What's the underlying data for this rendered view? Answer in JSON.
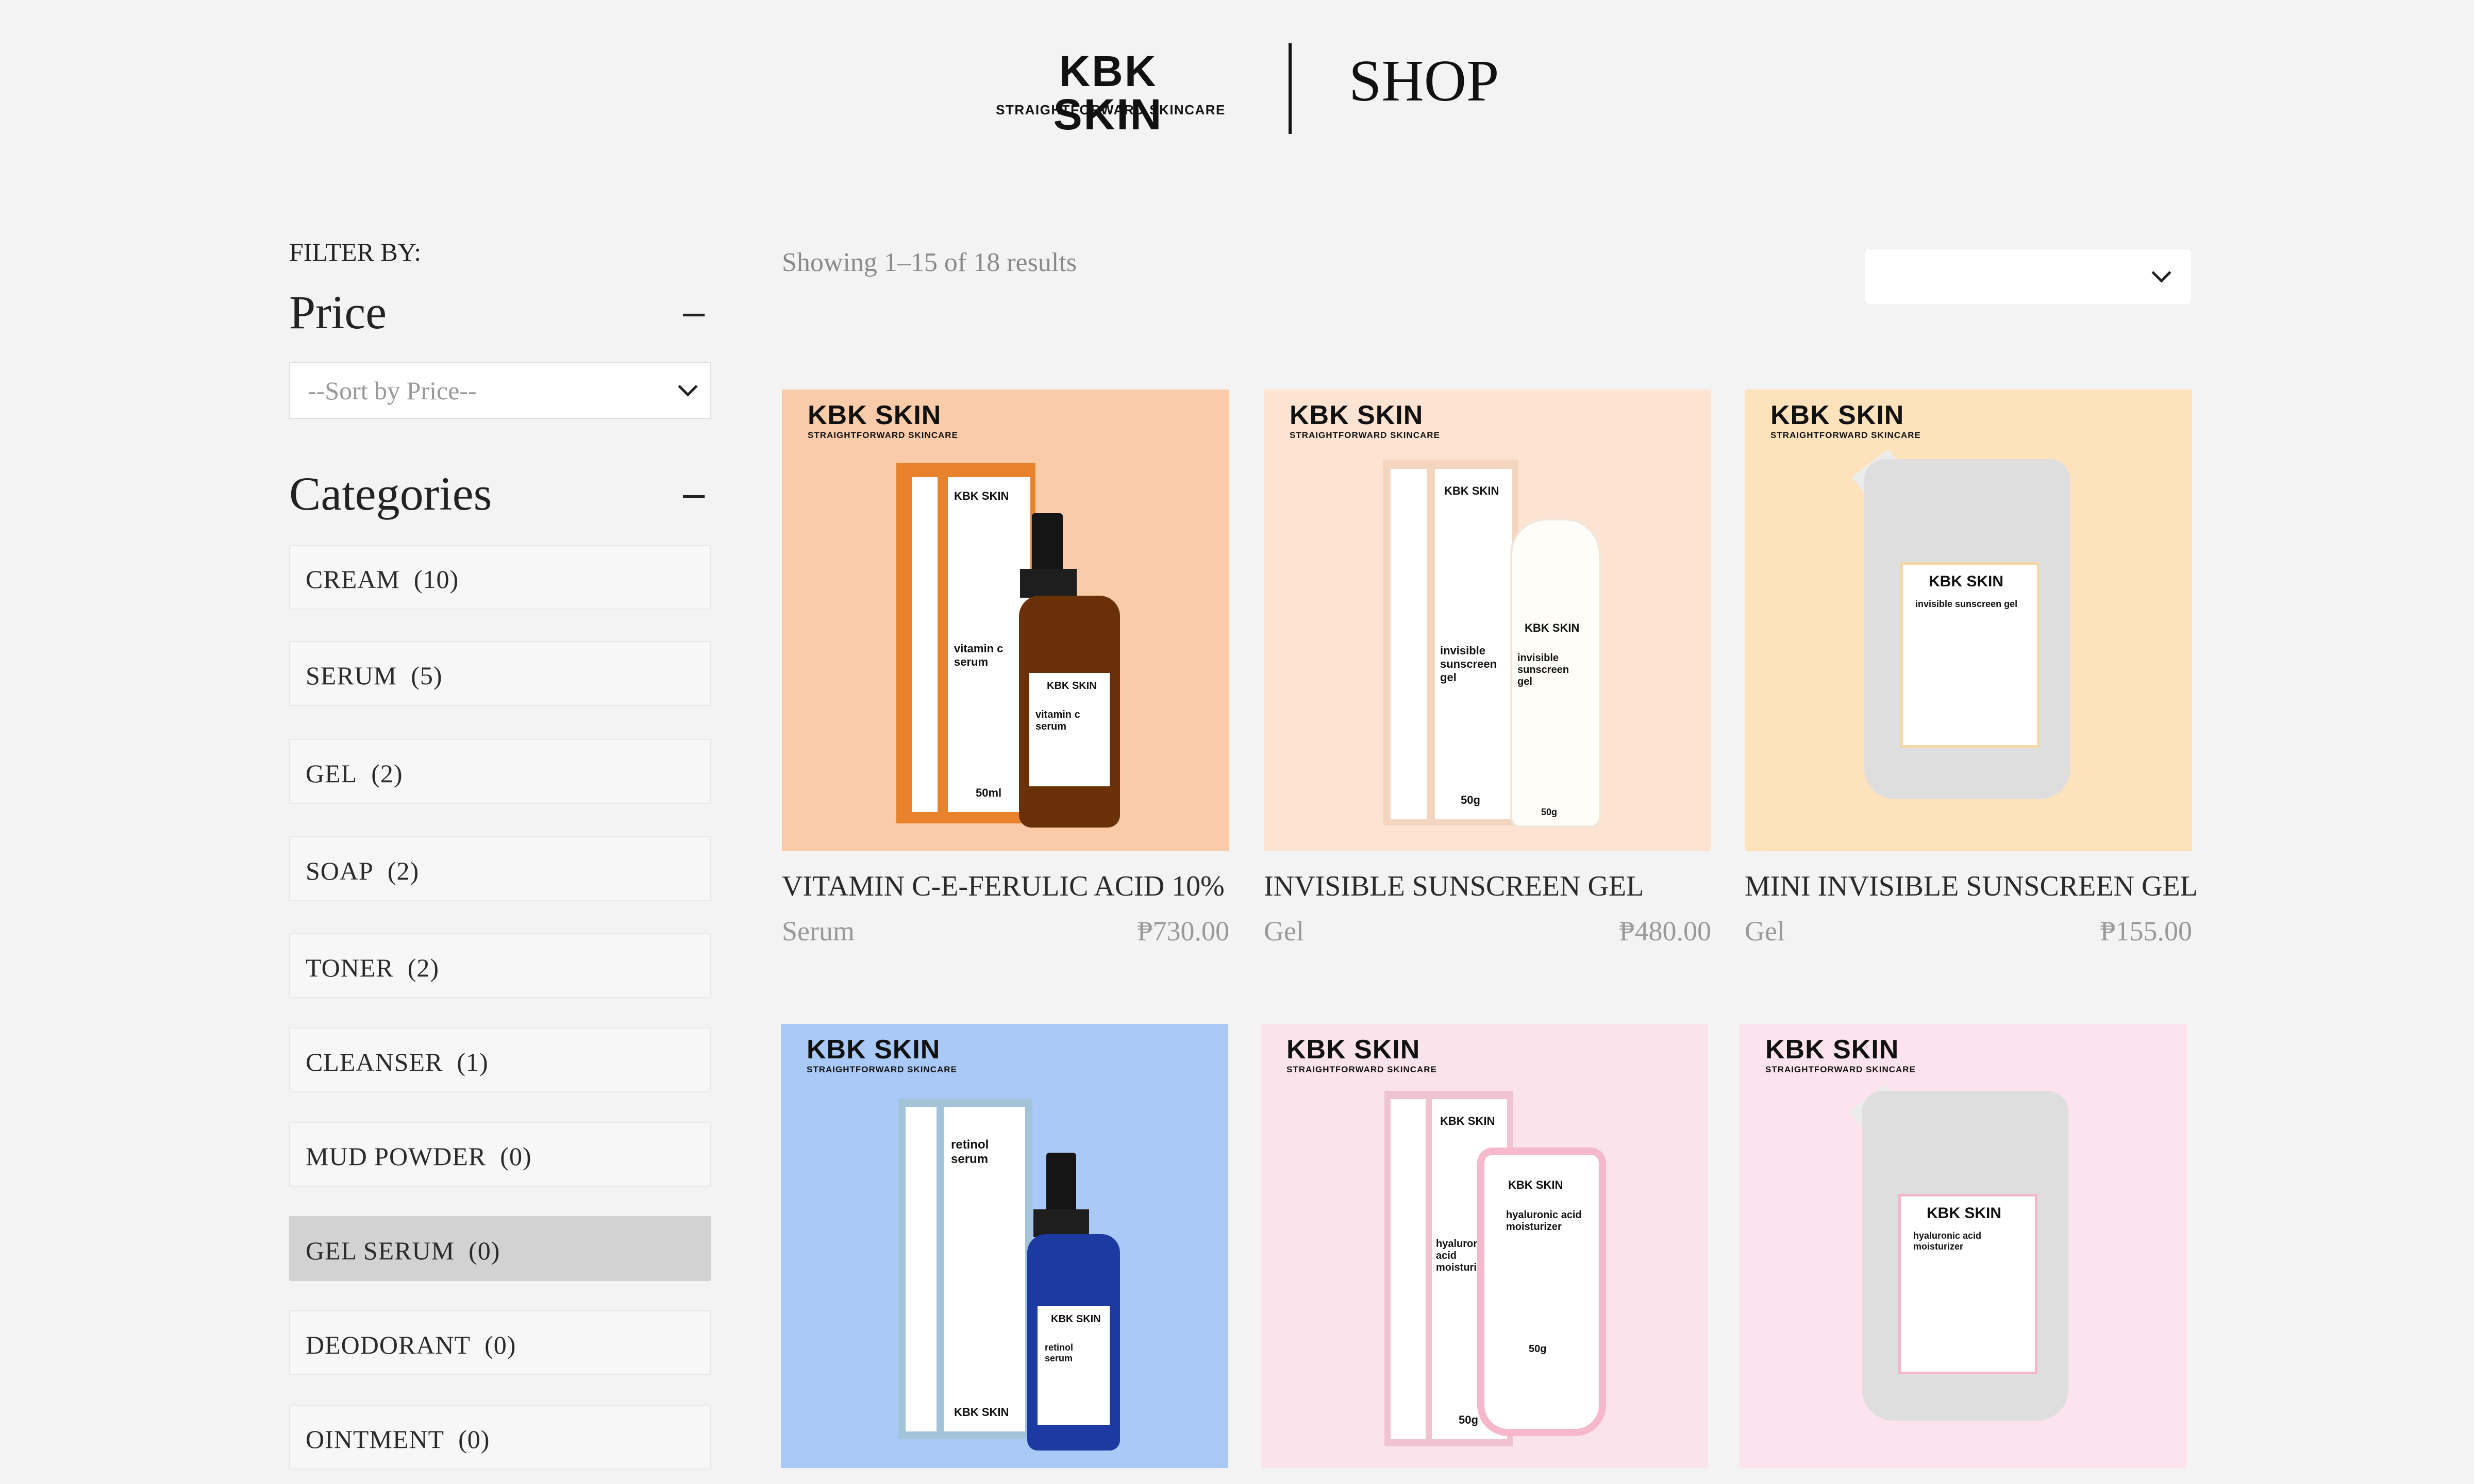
{
  "header": {
    "brand": "KBK SKIN",
    "tagline": "STRAIGHTFORWARD SKINCARE",
    "page_title": "SHOP"
  },
  "sidebar": {
    "filter_by": "FILTER BY:",
    "price": {
      "title": "Price",
      "select_value": "--Sort by Price--"
    },
    "categories": {
      "title": "Categories",
      "items": [
        {
          "label": "CREAM",
          "count": "(10)"
        },
        {
          "label": "SERUM",
          "count": "(5)"
        },
        {
          "label": "GEL",
          "count": "(2)"
        },
        {
          "label": "SOAP",
          "count": "(2)"
        },
        {
          "label": "TONER",
          "count": "(2)"
        },
        {
          "label": "CLEANSER",
          "count": "(1)"
        },
        {
          "label": "MUD POWDER",
          "count": "(0)"
        },
        {
          "label": "GEL SERUM",
          "count": "(0)"
        },
        {
          "label": "DEODORANT",
          "count": "(0)"
        },
        {
          "label": "OINTMENT",
          "count": "(0)"
        }
      ]
    }
  },
  "main": {
    "results_text": "Showing 1–15 of 18 results",
    "sort_value": "",
    "products": [
      {
        "title": "VITAMIN C-E-FERULIC ACID 10%",
        "category": "Serum",
        "price": "₱730.00",
        "bg": "#f9cba8",
        "box_label": "vitamin c serum",
        "bottle_label": "vitamin c serum",
        "size": "50ml"
      },
      {
        "title": "INVISIBLE SUNSCREEN GEL",
        "category": "Gel",
        "price": "₱480.00",
        "bg": "#fde3d2",
        "box_label": "invisible sunscreen gel",
        "bottle_label": "invisible sunscreen gel",
        "size": "50g"
      },
      {
        "title": "MINI INVISIBLE SUNSCREEN GEL",
        "category": "Gel",
        "price": "₱155.00",
        "bg": "#fde2bc",
        "pouch_label": "invisible sunscreen gel"
      },
      {
        "bg": "#a9caf6",
        "box_label": "retinol serum",
        "bottle_label": "retinol serum"
      },
      {
        "bg": "#fbe3ec",
        "box_label": "hyaluronic acid moisturizer",
        "bottle_label": "hyaluronic acid moisturizer",
        "size": "50g"
      },
      {
        "bg": "#fde3ee",
        "pouch_label": "hyaluronic acid moisturizer"
      }
    ],
    "brand_small": "KBK SKIN",
    "tagline_small": "STRAIGHTFORWARD SKINCARE"
  }
}
